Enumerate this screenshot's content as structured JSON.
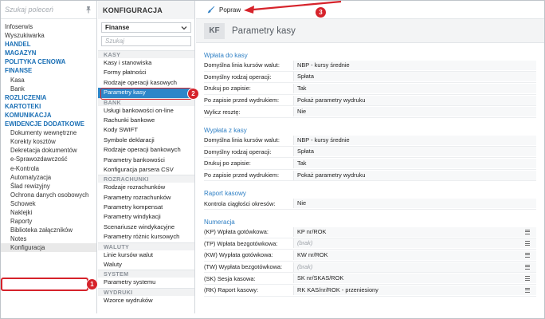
{
  "sidebar": {
    "search_placeholder": "Szukaj poleceń",
    "items": [
      {
        "label": "Infoserwis",
        "kind": "plain"
      },
      {
        "label": "Wyszukiwarka",
        "kind": "plain"
      },
      {
        "label": "HANDEL",
        "kind": "grp"
      },
      {
        "label": "MAGAZYN",
        "kind": "grp"
      },
      {
        "label": "POLITYKA CENOWA",
        "kind": "grp"
      },
      {
        "label": "FINANSE",
        "kind": "grp"
      },
      {
        "label": "Kasa",
        "kind": "sub"
      },
      {
        "label": "Bank",
        "kind": "sub"
      },
      {
        "label": "ROZLICZENIA",
        "kind": "grp"
      },
      {
        "label": "KARTOTEKI",
        "kind": "grp"
      },
      {
        "label": "KOMUNIKACJA",
        "kind": "grp"
      },
      {
        "label": "EWIDENCJE DODATKOWE",
        "kind": "grp"
      },
      {
        "label": "Dokumenty wewnętrzne",
        "kind": "sub"
      },
      {
        "label": "Korekty kosztów",
        "kind": "sub"
      },
      {
        "label": "Dekretacja dokumentów",
        "kind": "sub"
      },
      {
        "label": "e-Sprawozdawczość",
        "kind": "sub"
      },
      {
        "label": "e-Kontrola",
        "kind": "sub"
      },
      {
        "label": "Automatyzacja",
        "kind": "sub"
      },
      {
        "label": "Ślad rewizyjny",
        "kind": "sub"
      },
      {
        "label": "Ochrona danych osobowych",
        "kind": "sub"
      },
      {
        "label": "Schowek",
        "kind": "sub"
      },
      {
        "label": "Naklejki",
        "kind": "sub"
      },
      {
        "label": "Raporty",
        "kind": "sub"
      },
      {
        "label": "Biblioteka załączników",
        "kind": "sub"
      },
      {
        "label": "Notes",
        "kind": "sub"
      },
      {
        "label": "Konfiguracja",
        "kind": "sub"
      }
    ]
  },
  "config": {
    "header": "KONFIGURACJA",
    "dropdown_value": "Finanse",
    "search_placeholder": "Szukaj",
    "groups": [
      {
        "title": "KASY",
        "items": [
          "Kasy i stanowiska",
          "Formy płatności",
          "Rodzaje operacji kasowych",
          "Parametry kasy"
        ]
      },
      {
        "title": "BANK",
        "items": [
          "Usługi bankowości on-line",
          "Rachunki bankowe",
          "Kody SWIFT",
          "Symbole deklaracji",
          "Rodzaje operacji bankowych",
          "Parametry bankowości",
          "Konfiguracja parsera CSV"
        ]
      },
      {
        "title": "ROZRACHUNKI",
        "items": [
          "Rodzaje rozrachunków",
          "Parametry rozrachunków",
          "Parametry kompensat",
          "Parametry windykacji",
          "Scenariusze windykacyjne",
          "Parametry różnic kursowych"
        ]
      },
      {
        "title": "WALUTY",
        "items": [
          "Linie kursów walut",
          "Waluty"
        ]
      },
      {
        "title": "SYSTEM",
        "items": [
          "Parametry systemu"
        ]
      },
      {
        "title": "WYDRUKI",
        "items": [
          "Wzorce wydruków"
        ]
      }
    ],
    "selected": "Parametry kasy"
  },
  "toolbar": {
    "fix_label": "Popraw"
  },
  "page": {
    "badge": "KF",
    "title": "Parametry kasy"
  },
  "sections": [
    {
      "title": "Wpłata do kasy",
      "rows": [
        {
          "k": "Domyślna linia kursów walut:",
          "v": "NBP - kursy średnie"
        },
        {
          "k": "Domyślny rodzaj operacji:",
          "v": "Spłata"
        },
        {
          "k": "Drukuj po zapisie:",
          "v": "Tak"
        },
        {
          "k": "Po zapisie przed wydrukiem:",
          "v": "Pokaż parametry wydruku"
        },
        {
          "k": "Wylicz resztę:",
          "v": "Nie"
        }
      ]
    },
    {
      "title": "Wypłata z kasy",
      "rows": [
        {
          "k": "Domyślna linia kursów walut:",
          "v": "NBP - kursy średnie"
        },
        {
          "k": "Domyślny rodzaj operacji:",
          "v": "Spłata"
        },
        {
          "k": "Drukuj po zapisie:",
          "v": "Tak"
        },
        {
          "k": "Po zapisie przed wydrukiem:",
          "v": "Pokaż parametry wydruku"
        }
      ]
    },
    {
      "title": "Raport kasowy",
      "rows": [
        {
          "k": "Kontrola ciągłości okresów:",
          "v": "Nie"
        }
      ]
    },
    {
      "title": "Numeracja",
      "rows": [
        {
          "k": "(KP) Wpłata gotówkowa:",
          "v": "KP nr/ROK",
          "menu": true
        },
        {
          "k": "(TP) Wpłata bezgotówkowa:",
          "v": "(brak)",
          "muted": true,
          "menu": true
        },
        {
          "k": "(KW) Wypłata gotówkowa:",
          "v": "KW nr/ROK",
          "menu": true
        },
        {
          "k": "(TW) Wypłata bezgotówkowa:",
          "v": "(brak)",
          "muted": true,
          "menu": true
        },
        {
          "k": "(SK) Sesja kasowa:",
          "v": "SK nr/SKAS/ROK",
          "menu": true
        },
        {
          "k": "(RK) Raport kasowy:",
          "v": "RK KAS/nr/ROK - przeniesiony",
          "menu": true
        }
      ]
    }
  ],
  "annotations": {
    "step1": "1",
    "step2": "2",
    "step3": "3",
    "color": "#d6232b"
  }
}
